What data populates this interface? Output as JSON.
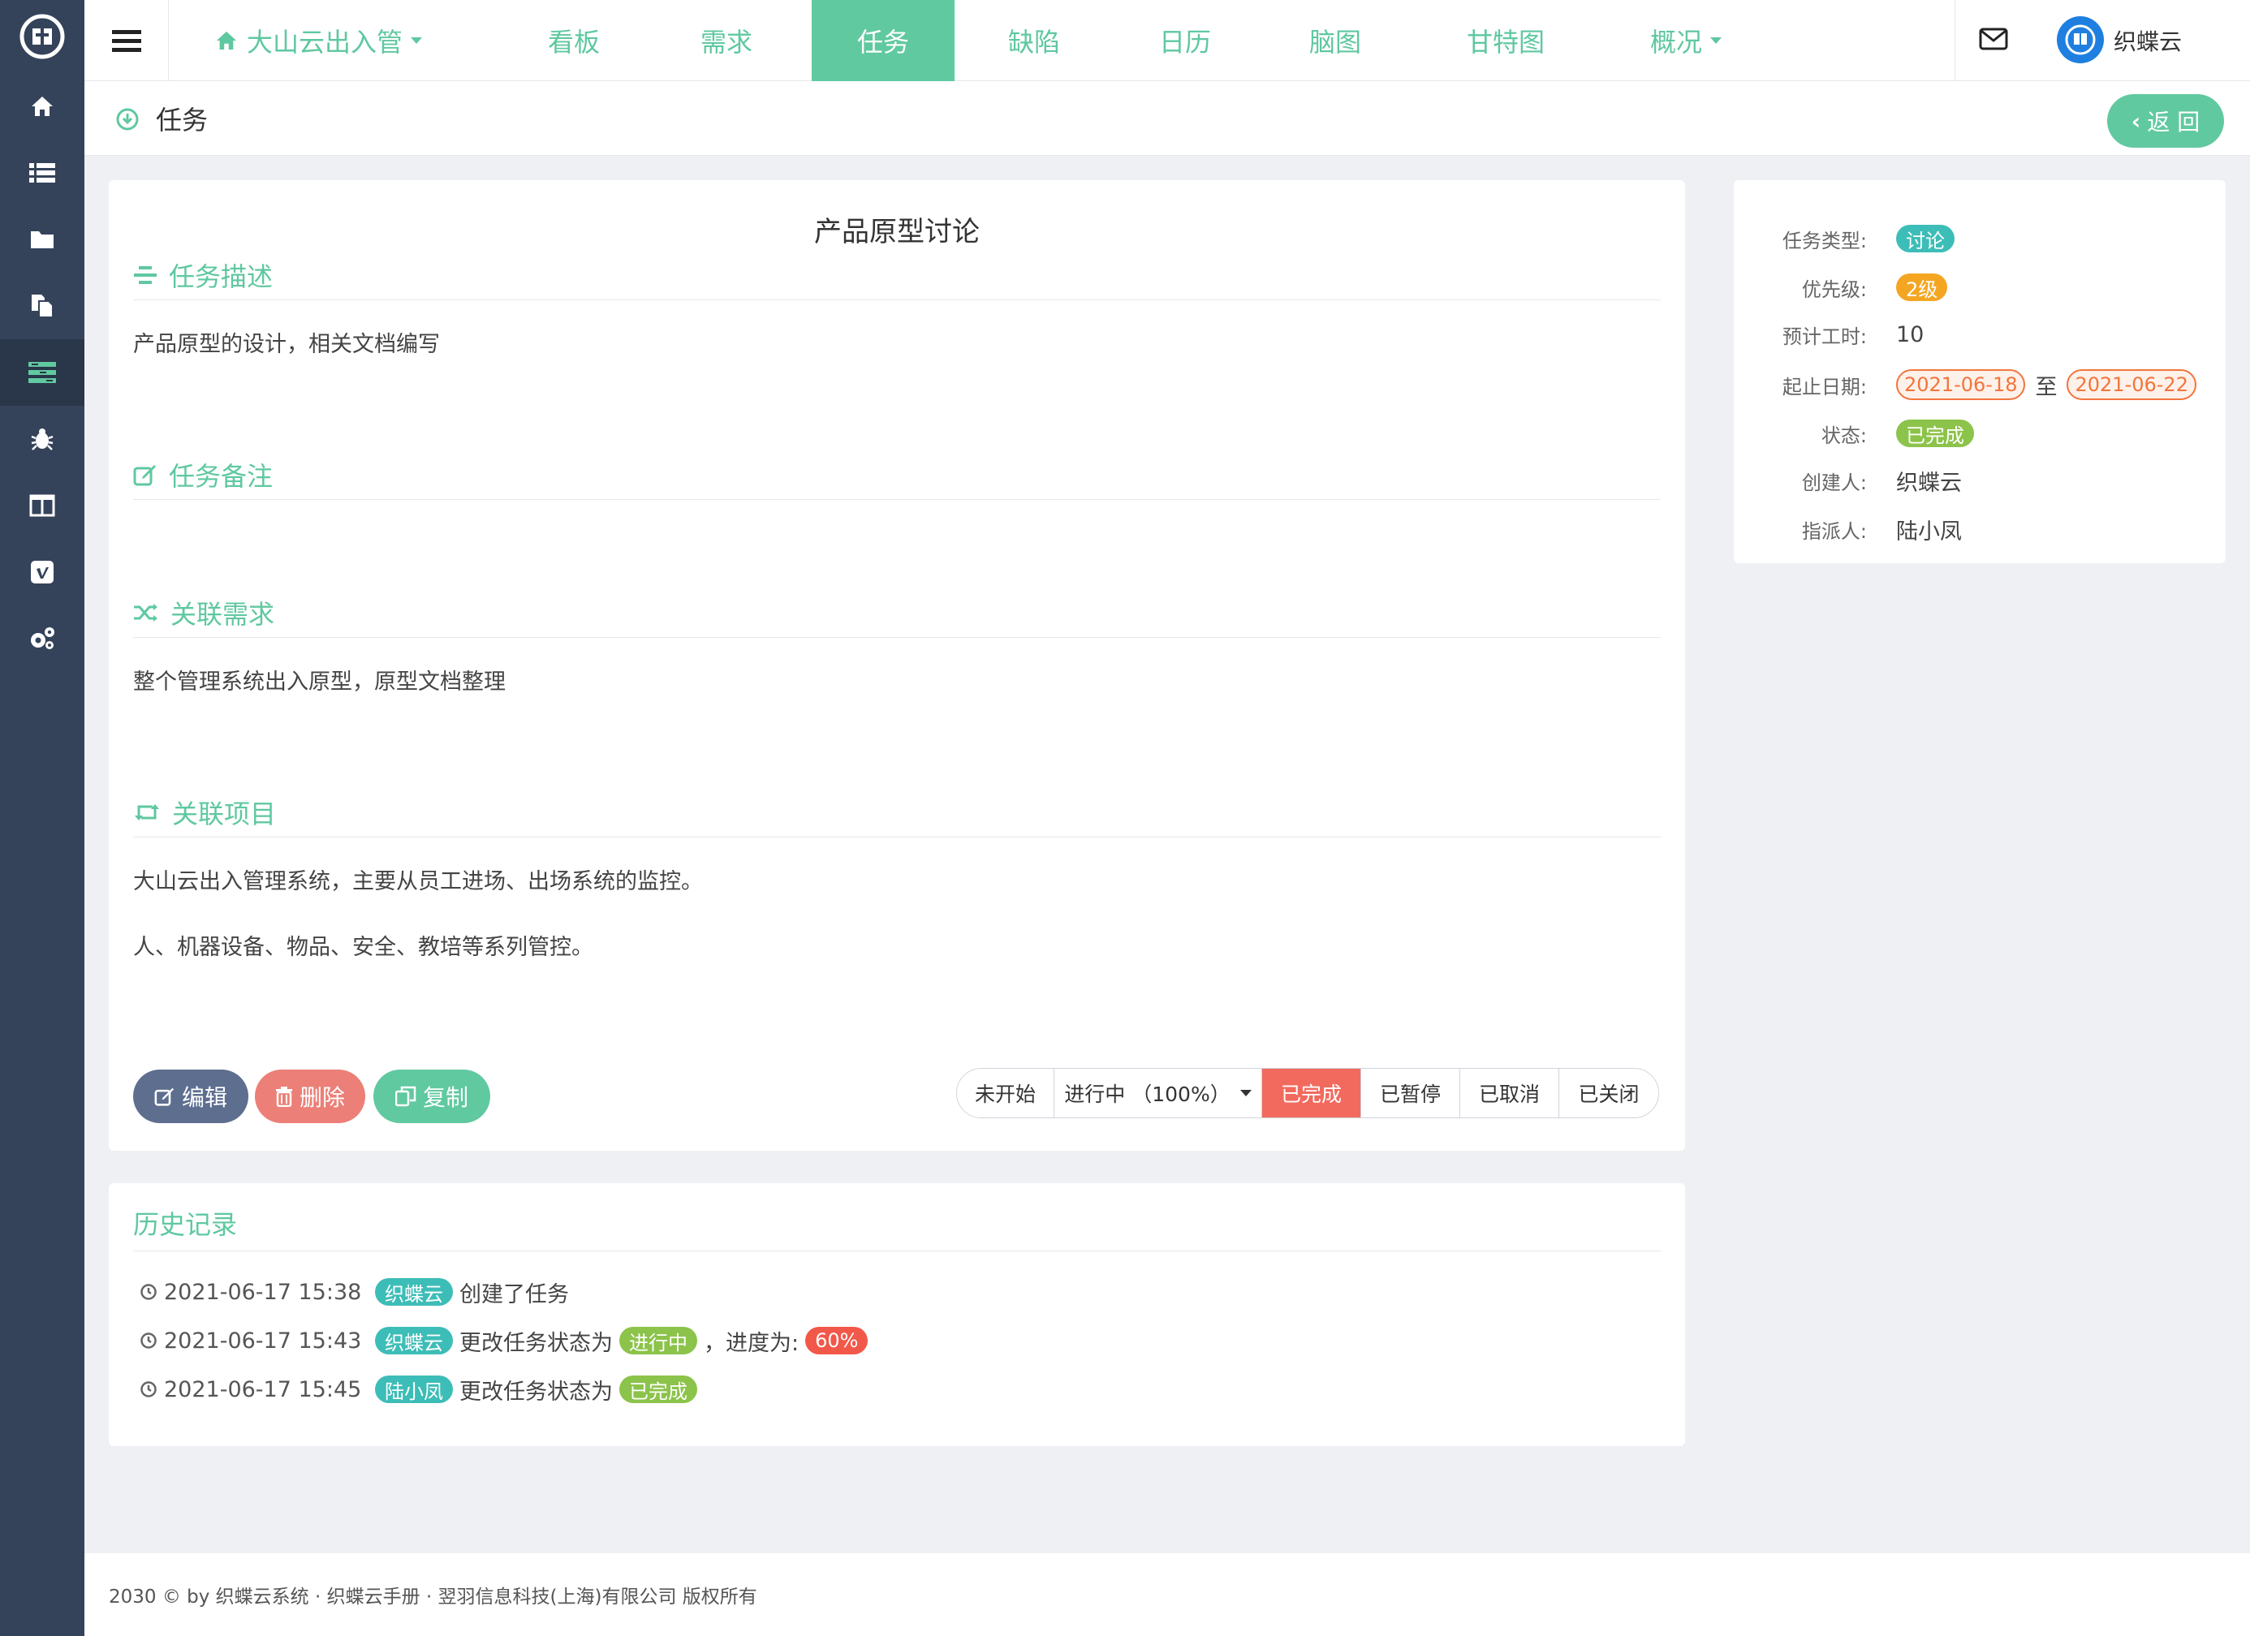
{
  "sidebar": {
    "items": [
      {
        "icon": "home-icon"
      },
      {
        "icon": "list-icon"
      },
      {
        "icon": "folder-icon"
      },
      {
        "icon": "documents-icon"
      },
      {
        "icon": "tasks-icon",
        "active": true
      },
      {
        "icon": "bug-icon"
      },
      {
        "icon": "columns-icon"
      },
      {
        "icon": "vimeo-icon"
      },
      {
        "icon": "settings-icon"
      }
    ]
  },
  "topnav": {
    "project_label": "大山云出入管",
    "tabs": [
      {
        "label": "看板"
      },
      {
        "label": "需求"
      },
      {
        "label": "任务",
        "active": true
      },
      {
        "label": "缺陷"
      },
      {
        "label": "日历"
      },
      {
        "label": "脑图"
      },
      {
        "label": "甘特图"
      },
      {
        "label": "概况"
      }
    ],
    "user_name": "织蝶云"
  },
  "breadcrumb": {
    "title": "任务",
    "back_label": "返 回"
  },
  "task": {
    "title": "产品原型讨论",
    "sections": {
      "description": {
        "heading": "任务描述",
        "body": "产品原型的设计，相关文档编写"
      },
      "remark": {
        "heading": "任务备注",
        "body": ""
      },
      "requirement": {
        "heading": "关联需求",
        "body": "整个管理系统出入原型，原型文档整理"
      },
      "project": {
        "heading": "关联项目",
        "lines": [
          "大山云出入管理系统，主要从员工进场、出场系统的监控。",
          "人、机器设备、物品、安全、教培等系列管控。"
        ]
      }
    },
    "actions": {
      "edit": "编辑",
      "delete": "删除",
      "copy": "复制"
    },
    "status_buttons": {
      "not_started": "未开始",
      "in_progress": "进行中 （100%）",
      "done": "已完成",
      "paused": "已暂停",
      "cancelled": "已取消",
      "closed": "已关闭"
    }
  },
  "history": {
    "heading": "历史记录",
    "rows": [
      {
        "time": "2021-06-17 15:38",
        "user": "织蝶云",
        "text": "创建了任务"
      },
      {
        "time": "2021-06-17 15:43",
        "user": "织蝶云",
        "text": "更改任务状态为",
        "status": "进行中",
        "extra": "，进度为:",
        "progress": "60%"
      },
      {
        "time": "2021-06-17 15:45",
        "user": "陆小凤",
        "text": "更改任务状态为",
        "status": "已完成"
      }
    ]
  },
  "info": {
    "type_label": "任务类型:",
    "type_value": "讨论",
    "priority_label": "优先级:",
    "priority_value": "2级",
    "hours_label": "预计工时:",
    "hours_value": "10",
    "dates_label": "起止日期:",
    "start_date": "2021-06-18",
    "date_sep": "至",
    "end_date": "2021-06-22",
    "status_label": "状态:",
    "status_value": "已完成",
    "creator_label": "创建人:",
    "creator_value": "织蝶云",
    "assignee_label": "指派人:",
    "assignee_value": "陆小凤"
  },
  "footer": {
    "text": "2030 © by 织蝶云系统 · 织蝶云手册 · 翌羽信息科技(上海)有限公司 版权所有"
  },
  "colors": {
    "accent": "#60c9a0",
    "sidebar": "#34435a",
    "danger": "#f26a5e",
    "edit": "#5e6e8f",
    "delete": "#ec7f77"
  }
}
